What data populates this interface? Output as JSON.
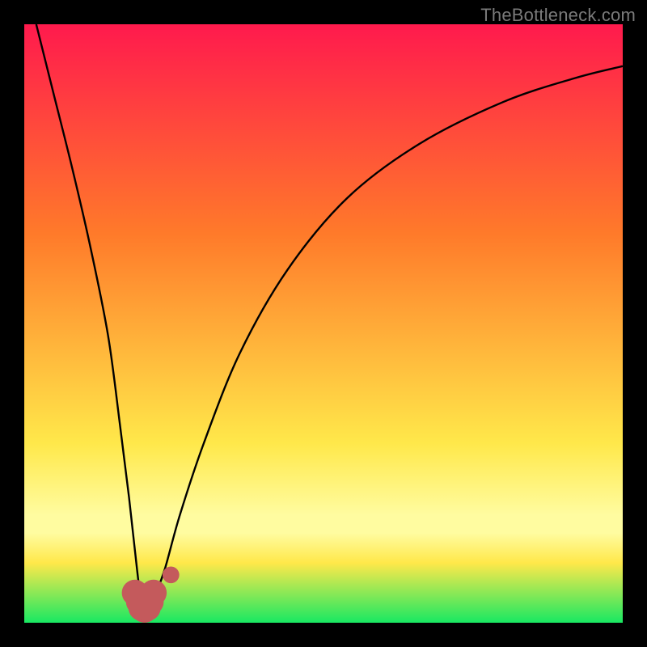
{
  "watermark": "TheBottleneck.com",
  "colors": {
    "frame": "#000000",
    "curve": "#000000",
    "marker": "#c45a5c",
    "gradient_top": "#ff1a4d",
    "gradient_mid_high": "#ff7a2a",
    "gradient_mid_low": "#ffe84a",
    "gradient_band": "#fffca0",
    "gradient_bottom": "#18e862"
  },
  "chart_data": {
    "type": "line",
    "title": "",
    "xlabel": "",
    "ylabel": "",
    "xlim": [
      0,
      100
    ],
    "ylim": [
      0,
      100
    ],
    "grid": false,
    "legend": false,
    "series": [
      {
        "name": "bottleneck-curve",
        "x": [
          2,
          5,
          8,
          11,
          14,
          16,
          17.5,
          18.5,
          19.2,
          19.8,
          20.3,
          21,
          22,
          23.5,
          26,
          30,
          36,
          44,
          54,
          66,
          80,
          92,
          100
        ],
        "values": [
          100,
          88,
          76,
          63,
          48,
          33,
          21,
          12,
          6,
          3,
          2.5,
          3,
          5,
          9,
          18,
          30,
          45,
          59,
          71,
          80,
          87,
          91,
          93
        ]
      }
    ],
    "markers": [
      {
        "name": "cluster-a",
        "x": 18.5,
        "y": 5,
        "r": 2.2
      },
      {
        "name": "cluster-b",
        "x": 19.2,
        "y": 3.5,
        "r": 2.2
      },
      {
        "name": "cluster-c",
        "x": 19.6,
        "y": 2.5,
        "r": 2.2
      },
      {
        "name": "cluster-d",
        "x": 20.1,
        "y": 2.2,
        "r": 2.2
      },
      {
        "name": "cluster-e",
        "x": 20.6,
        "y": 2.5,
        "r": 2.2
      },
      {
        "name": "cluster-f",
        "x": 21.1,
        "y": 3.5,
        "r": 2.2
      },
      {
        "name": "cluster-g",
        "x": 21.6,
        "y": 5,
        "r": 2.2
      },
      {
        "name": "outlier",
        "x": 24.5,
        "y": 8,
        "r": 1.4
      }
    ],
    "gradient_stops_pct": [
      0,
      35,
      70,
      82,
      85,
      90,
      100
    ]
  }
}
